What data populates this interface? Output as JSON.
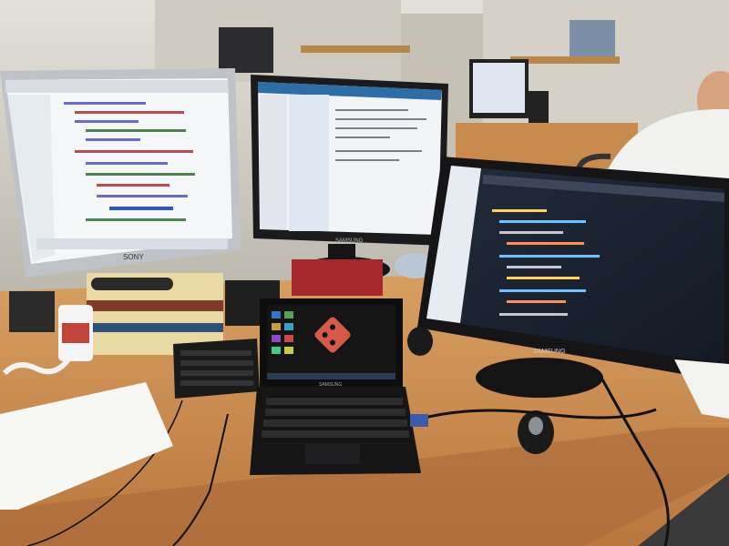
{
  "brands": {
    "left_monitor": "SONY",
    "center_monitor": "SAMSUNG",
    "right_monitor": "SAMSUNG",
    "netbook": "SAMSUNG"
  },
  "colors": {
    "desk": "#c98a4e",
    "wall": "#d9d6cf",
    "partition": "#cfcac0",
    "monitor_bezel": "#1b1b1d",
    "sony_bezel": "#bfc2c6",
    "ide_light_bg": "#f4f6f8",
    "ide_dark_bg": "#1d2635",
    "git_logo": "#d65a48",
    "laptop_wallpaper": "#151515"
  },
  "icons": [
    "git-logo-icon",
    "desktop-app-icon"
  ]
}
